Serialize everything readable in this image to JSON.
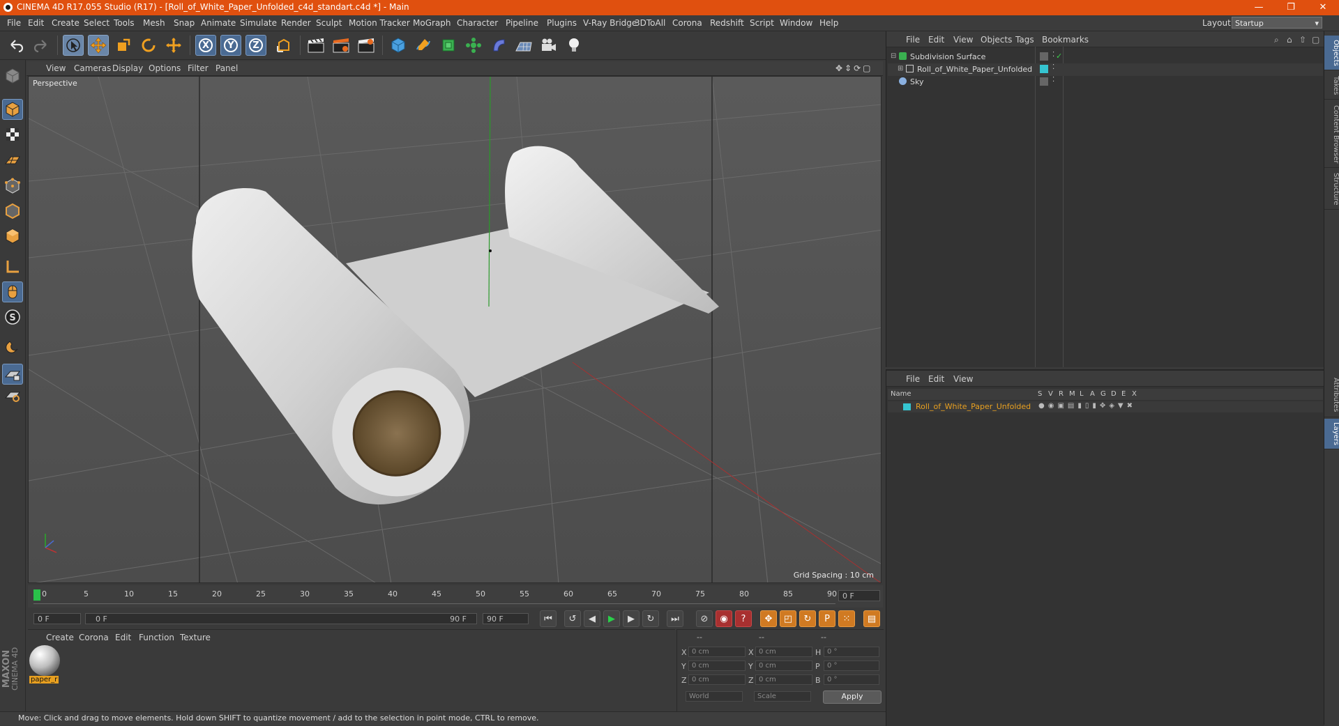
{
  "window": {
    "title": "CINEMA 4D R17.055 Studio (R17) - [Roll_of_White_Paper_Unfolded_c4d_standart.c4d *] - Main",
    "minimize": "—",
    "maximize": "❐",
    "close": "✕"
  },
  "menu": [
    "File",
    "Edit",
    "Create",
    "Select",
    "Tools",
    "Mesh",
    "Snap",
    "Animate",
    "Simulate",
    "Render",
    "Sculpt",
    "Motion Tracker",
    "MoGraph",
    "Character",
    "Pipeline",
    "Plugins",
    "V-Ray Bridge",
    "3DToAll",
    "Corona",
    "Redshift",
    "Script",
    "Window",
    "Help"
  ],
  "layout": {
    "label": "Layout:",
    "value": "Startup"
  },
  "toolbar": {
    "x": "X",
    "y": "Y",
    "z": "Z"
  },
  "viewport": {
    "menu": [
      "View",
      "Cameras",
      "Display",
      "Options",
      "Filter",
      "Panel"
    ],
    "label": "Perspective",
    "grid_spacing": "Grid Spacing : 10 cm"
  },
  "timeline": {
    "ticks": [
      "0",
      "5",
      "10",
      "15",
      "20",
      "25",
      "30",
      "35",
      "40",
      "45",
      "50",
      "55",
      "60",
      "65",
      "70",
      "75",
      "80",
      "85",
      "90"
    ],
    "current_frame": "0 F",
    "start": "0 F",
    "range_start": "0 F",
    "range_end": "90 F",
    "end": "90 F"
  },
  "material_manager": {
    "menu": [
      "Create",
      "Corona",
      "Edit",
      "Function",
      "Texture"
    ],
    "material_name": "paper_r",
    "brand_line1": "MAXON",
    "brand_line2": "CINEMA 4D"
  },
  "coords": {
    "header": [
      "--",
      "--",
      "--"
    ],
    "rows": [
      {
        "a": "X",
        "av": "0 cm",
        "b": "X",
        "bv": "0 cm",
        "c": "H",
        "cv": "0 °"
      },
      {
        "a": "Y",
        "av": "0 cm",
        "b": "Y",
        "bv": "0 cm",
        "c": "P",
        "cv": "0 °"
      },
      {
        "a": "Z",
        "av": "0 cm",
        "b": "Z",
        "bv": "0 cm",
        "c": "B",
        "cv": "0 °"
      }
    ],
    "world": "World",
    "scale": "Scale",
    "apply": "Apply"
  },
  "status": "Move: Click and drag to move elements. Hold down SHIFT to quantize movement / add to the selection in point mode, CTRL to remove.",
  "object_manager": {
    "menu": [
      "File",
      "Edit",
      "View",
      "Objects",
      "Tags",
      "Bookmarks"
    ],
    "objects": [
      "Subdivision Surface",
      "Roll_of_White_Paper_Unfolded",
      "Sky"
    ]
  },
  "layer_manager": {
    "menu": [
      "File",
      "Edit",
      "View"
    ],
    "name_col": "Name",
    "cols": [
      "S",
      "V",
      "R",
      "M",
      "L",
      "A",
      "G",
      "D",
      "E",
      "X"
    ],
    "layer": "Roll_of_White_Paper_Unfolded"
  },
  "right_tabs": [
    "Objects",
    "Takes",
    "Content Browser",
    "Structure",
    "Attributes",
    "Layers"
  ],
  "colors": {
    "title_bar": "#e0500f",
    "accent_blue": "#4a6a92",
    "layer_color": "#35c4d0",
    "layer_name": "#e8a020"
  }
}
